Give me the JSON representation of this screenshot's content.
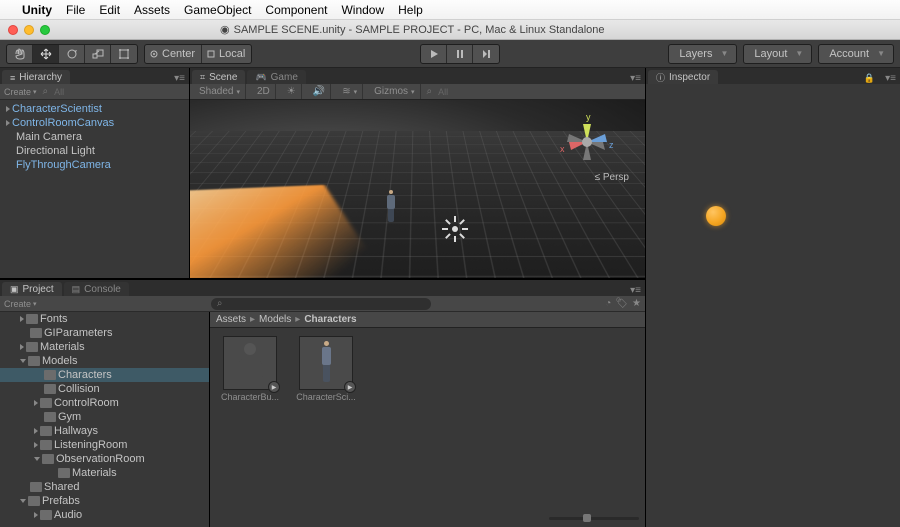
{
  "mac_menu": {
    "app": "Unity",
    "items": [
      "File",
      "Edit",
      "Assets",
      "GameObject",
      "Component",
      "Window",
      "Help"
    ]
  },
  "window_title": "SAMPLE SCENE.unity - SAMPLE PROJECT - PC, Mac & Linux Standalone",
  "toolbar": {
    "pivot_label": "Center",
    "space_label": "Local",
    "layers": "Layers",
    "layout": "Layout",
    "account": "Account"
  },
  "hierarchy": {
    "tab": "Hierarchy",
    "create": "Create",
    "search_placeholder": "All",
    "items": [
      {
        "label": "CharacterScientist",
        "expand": "r",
        "sel": true
      },
      {
        "label": "ControlRoomCanvas",
        "expand": "r",
        "sel": true
      },
      {
        "label": "Main Camera",
        "expand": "",
        "sel": false
      },
      {
        "label": "Directional Light",
        "expand": "",
        "sel": false
      },
      {
        "label": "FlyThroughCamera",
        "expand": "",
        "sel": true
      }
    ]
  },
  "scene": {
    "tab_scene": "Scene",
    "tab_game": "Game",
    "shading": "Shaded",
    "mode_2d": "2D",
    "gizmos": "Gizmos",
    "search_placeholder": "All",
    "persp": "Persp"
  },
  "project": {
    "tab_project": "Project",
    "tab_console": "Console",
    "create": "Create",
    "tree": [
      {
        "label": "Fonts",
        "ind": 1,
        "expand": "r"
      },
      {
        "label": "GIParameters",
        "ind": 1,
        "expand": ""
      },
      {
        "label": "Materials",
        "ind": 1,
        "expand": "r"
      },
      {
        "label": "Models",
        "ind": 1,
        "expand": "d"
      },
      {
        "label": "Characters",
        "ind": 2,
        "expand": "",
        "sel": true
      },
      {
        "label": "Collision",
        "ind": 2,
        "expand": ""
      },
      {
        "label": "ControlRoom",
        "ind": 2,
        "expand": "r"
      },
      {
        "label": "Gym",
        "ind": 2,
        "expand": ""
      },
      {
        "label": "Hallways",
        "ind": 2,
        "expand": "r"
      },
      {
        "label": "ListeningRoom",
        "ind": 2,
        "expand": "r"
      },
      {
        "label": "ObservationRoom",
        "ind": 2,
        "expand": "d"
      },
      {
        "label": "Materials",
        "ind": 3,
        "expand": ""
      },
      {
        "label": "Shared",
        "ind": 1,
        "expand": ""
      },
      {
        "label": "Prefabs",
        "ind": 1,
        "expand": "d"
      },
      {
        "label": "Audio",
        "ind": 2,
        "expand": "r"
      }
    ],
    "crumb": [
      "Assets",
      "Models",
      "Characters"
    ],
    "assets": [
      {
        "name": "CharacterBu..."
      },
      {
        "name": "CharacterSci..."
      }
    ]
  },
  "inspector": {
    "tab": "Inspector"
  }
}
